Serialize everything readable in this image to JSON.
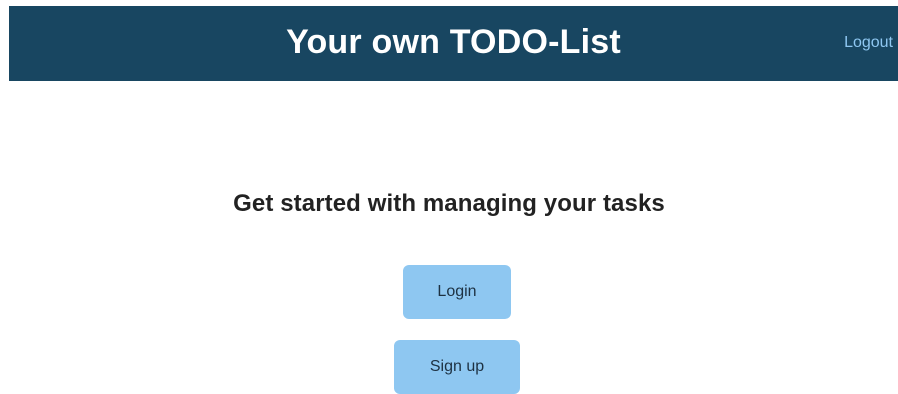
{
  "header": {
    "title": "Your own TODO-List",
    "logout_label": "Logout"
  },
  "main": {
    "tagline": "Get started with managing your tasks",
    "login_label": "Login",
    "signup_label": "Sign up"
  },
  "colors": {
    "header_bg": "#184661",
    "link": "#8ec7f1",
    "button_bg": "#8ec7f1"
  }
}
